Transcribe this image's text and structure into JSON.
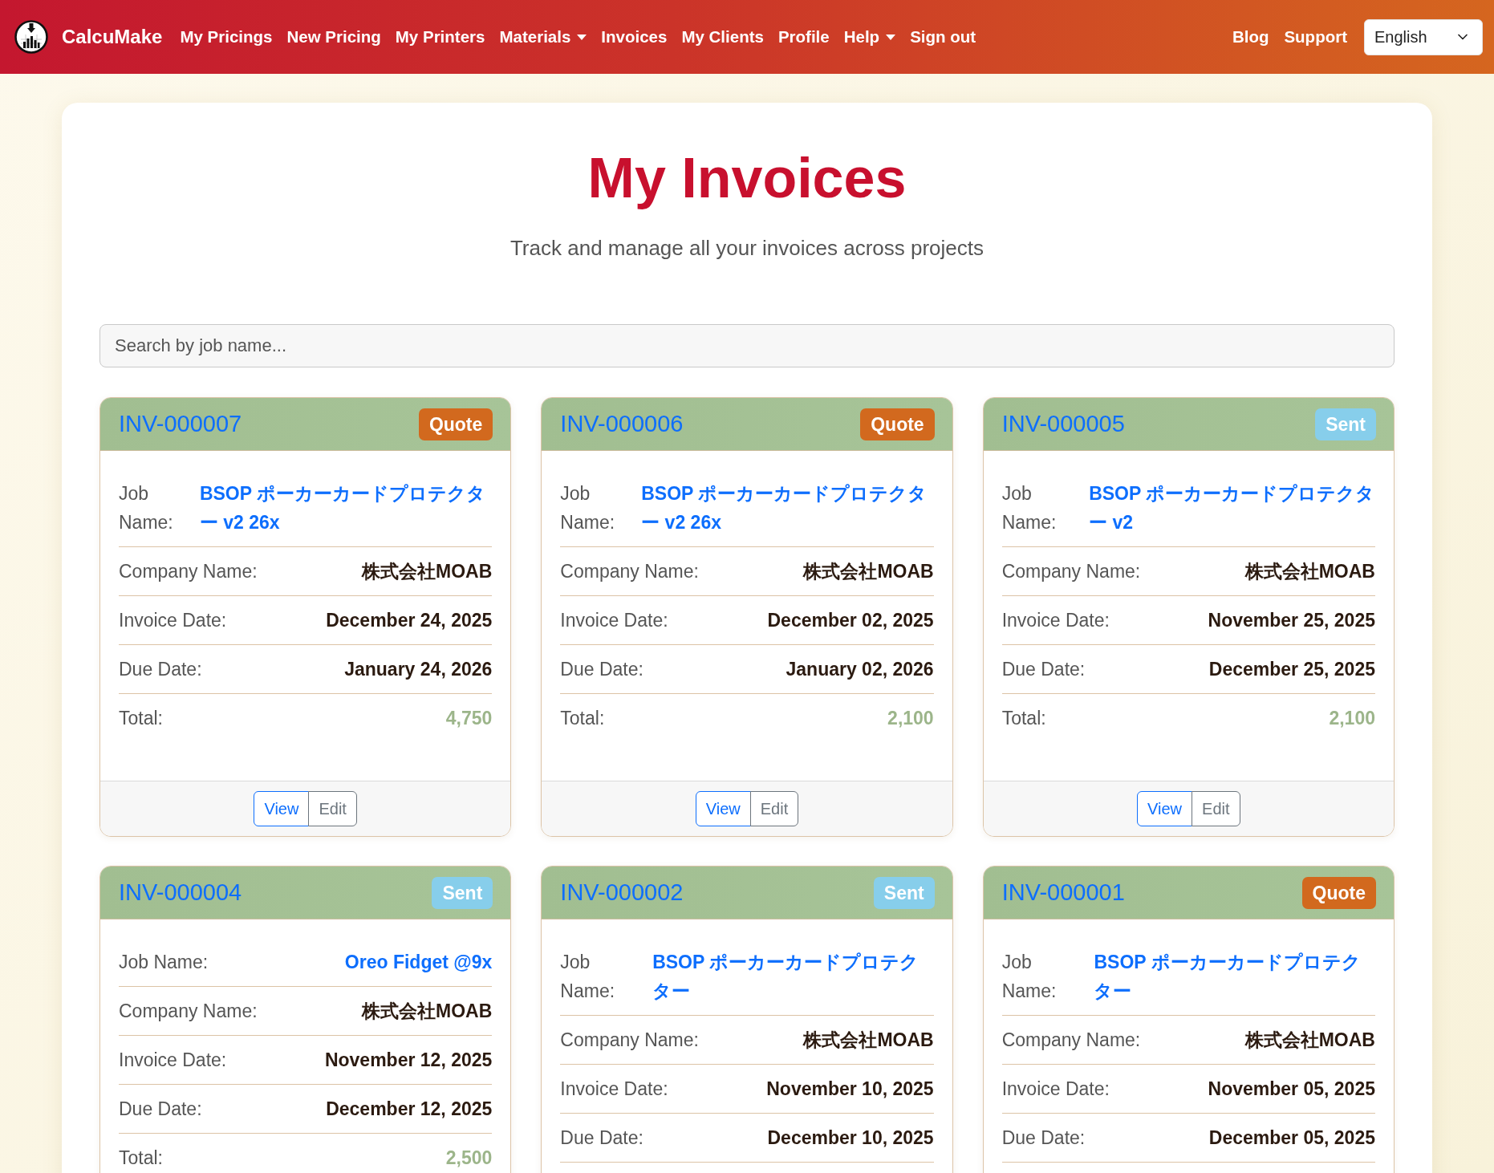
{
  "navbar": {
    "brand": "CalcuMake",
    "links": [
      {
        "label": "My Pricings",
        "dropdown": false
      },
      {
        "label": "New Pricing",
        "dropdown": false
      },
      {
        "label": "My Printers",
        "dropdown": false
      },
      {
        "label": "Materials",
        "dropdown": true
      },
      {
        "label": "Invoices",
        "dropdown": false
      },
      {
        "label": "My Clients",
        "dropdown": false
      },
      {
        "label": "Profile",
        "dropdown": false
      },
      {
        "label": "Help",
        "dropdown": true
      },
      {
        "label": "Sign out",
        "dropdown": false
      }
    ],
    "right_links": [
      {
        "label": "Blog"
      },
      {
        "label": "Support"
      }
    ],
    "language_select": {
      "value": "English"
    }
  },
  "header": {
    "title": "My Invoices",
    "subtitle": "Track and manage all your invoices across projects"
  },
  "search": {
    "placeholder": "Search by job name..."
  },
  "invoices": [
    {
      "number": "INV-000007",
      "status": {
        "label": "Quote",
        "kind": "quote"
      },
      "fields": [
        {
          "label": "Job Name:",
          "value": "BSOP ポーカーカードプロテクター v2 26x",
          "kind": "link"
        },
        {
          "label": "Company Name:",
          "value": "株式会社MOAB",
          "kind": "text"
        },
        {
          "label": "Invoice Date:",
          "value": "December 24, 2025",
          "kind": "text"
        },
        {
          "label": "Due Date:",
          "value": "January 24, 2026",
          "kind": "text"
        },
        {
          "label": "Total:",
          "value": "4,750",
          "kind": "amount"
        }
      ],
      "actions": [
        {
          "label": "View",
          "kind": "view"
        },
        {
          "label": "Edit",
          "kind": "edit"
        }
      ]
    },
    {
      "number": "INV-000006",
      "status": {
        "label": "Quote",
        "kind": "quote"
      },
      "fields": [
        {
          "label": "Job Name:",
          "value": "BSOP ポーカーカードプロテクター v2 26x",
          "kind": "link"
        },
        {
          "label": "Company Name:",
          "value": "株式会社MOAB",
          "kind": "text"
        },
        {
          "label": "Invoice Date:",
          "value": "December 02, 2025",
          "kind": "text"
        },
        {
          "label": "Due Date:",
          "value": "January 02, 2026",
          "kind": "text"
        },
        {
          "label": "Total:",
          "value": "2,100",
          "kind": "amount"
        }
      ],
      "actions": [
        {
          "label": "View",
          "kind": "view"
        },
        {
          "label": "Edit",
          "kind": "edit"
        }
      ]
    },
    {
      "number": "INV-000005",
      "status": {
        "label": "Sent",
        "kind": "sent"
      },
      "fields": [
        {
          "label": "Job Name:",
          "value": "BSOP ポーカーカードプロテクター v2",
          "kind": "link"
        },
        {
          "label": "Company Name:",
          "value": "株式会社MOAB",
          "kind": "text"
        },
        {
          "label": "Invoice Date:",
          "value": "November 25, 2025",
          "kind": "text"
        },
        {
          "label": "Due Date:",
          "value": "December 25, 2025",
          "kind": "text"
        },
        {
          "label": "Total:",
          "value": "2,100",
          "kind": "amount"
        }
      ],
      "actions": [
        {
          "label": "View",
          "kind": "view"
        },
        {
          "label": "Edit",
          "kind": "edit"
        }
      ]
    },
    {
      "number": "INV-000004",
      "status": {
        "label": "Sent",
        "kind": "sent"
      },
      "fields": [
        {
          "label": "Job Name:",
          "value": "Oreo Fidget @9x",
          "kind": "link"
        },
        {
          "label": "Company Name:",
          "value": "株式会社MOAB",
          "kind": "text"
        },
        {
          "label": "Invoice Date:",
          "value": "November 12, 2025",
          "kind": "text"
        },
        {
          "label": "Due Date:",
          "value": "December 12, 2025",
          "kind": "text"
        },
        {
          "label": "Total:",
          "value": "2,500",
          "kind": "amount"
        }
      ]
    },
    {
      "number": "INV-000002",
      "status": {
        "label": "Sent",
        "kind": "sent"
      },
      "fields": [
        {
          "label": "Job Name:",
          "value": "BSOP ポーカーカードプロテクター",
          "kind": "link"
        },
        {
          "label": "Company Name:",
          "value": "株式会社MOAB",
          "kind": "text"
        },
        {
          "label": "Invoice Date:",
          "value": "November 10, 2025",
          "kind": "text"
        },
        {
          "label": "Due Date:",
          "value": "December 10, 2025",
          "kind": "text"
        }
      ]
    },
    {
      "number": "INV-000001",
      "status": {
        "label": "Quote",
        "kind": "quote"
      },
      "fields": [
        {
          "label": "Job Name:",
          "value": "BSOP ポーカーカードプロテクター",
          "kind": "link"
        },
        {
          "label": "Company Name:",
          "value": "株式会社MOAB",
          "kind": "text"
        },
        {
          "label": "Invoice Date:",
          "value": "November 05, 2025",
          "kind": "text"
        },
        {
          "label": "Due Date:",
          "value": "December 05, 2025",
          "kind": "text"
        }
      ]
    }
  ]
}
